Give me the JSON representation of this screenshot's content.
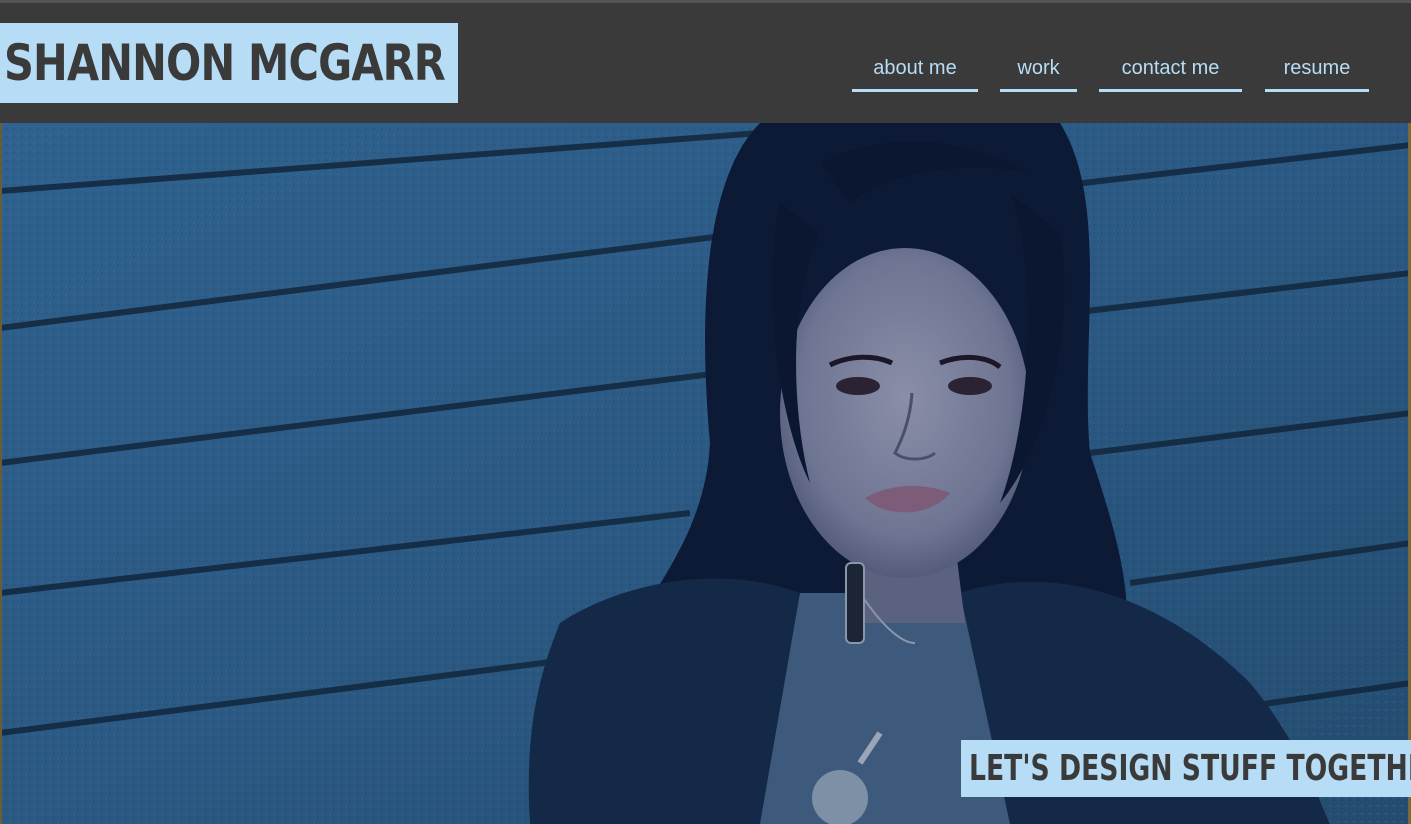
{
  "header": {
    "logo_text": "SHANNON MCGARR"
  },
  "nav": {
    "items": [
      {
        "label": "about me"
      },
      {
        "label": "work"
      },
      {
        "label": "contact me"
      },
      {
        "label": "resume"
      }
    ]
  },
  "hero": {
    "image_description_icon": "portrait-photo-icon",
    "tagline": "LET'S DESIGN STUFF TOGETHER!"
  },
  "colors": {
    "accent": "#b7dcf5",
    "background": "#3a3a3a",
    "hero_tint": "#2d5a84"
  }
}
